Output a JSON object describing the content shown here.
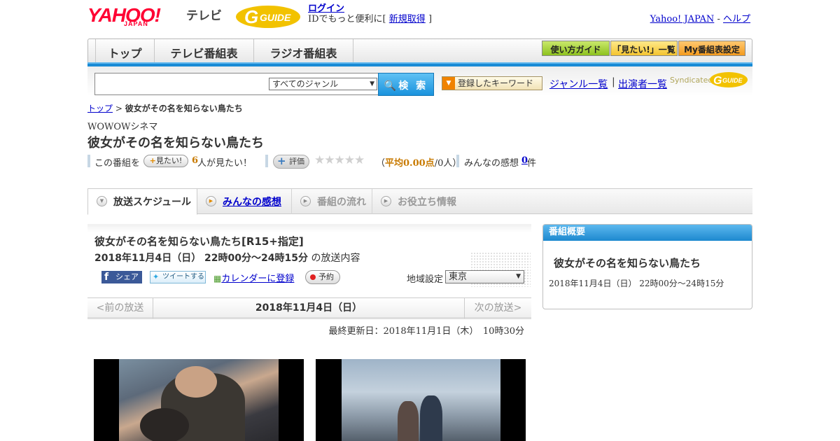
{
  "header": {
    "yahoo_logo": "YAHOO!",
    "yahoo_sub": "JAPAN",
    "tv_label": "テレビ",
    "gguide_logo": "G-GUIDE",
    "login": "ログイン",
    "login_note_pre": "IDでもっと便利に[",
    "signup": "新規取得",
    "login_note_post": "]",
    "yahoo_japan_link": "Yahoo! JAPAN",
    "dash": "-",
    "help_link": "ヘルプ"
  },
  "nav": {
    "tabs": [
      "トップ",
      "テレビ番組表",
      "ラジオ番組表"
    ],
    "guide_btn": "使い方ガイド",
    "watchlist_btn": "「見たい!」一覧",
    "my_btn": "My番組表設定"
  },
  "search": {
    "genre_selected": "すべてのジャンル",
    "button": "検 索",
    "keyword_btn": "登録したキーワード",
    "genre_link": "ジャンル一覧",
    "separator": "|",
    "cast_link": "出演者一覧",
    "syndicated": "Syndicated"
  },
  "breadcrumb": {
    "home": "トップ",
    "sep": ">",
    "current": "彼女がその名を知らない鳥たち"
  },
  "program": {
    "channel": "WOWOWシネマ",
    "title": "彼女がその名を知らない鳥たち",
    "this_program": "この番組を",
    "want_btn": "見たい!",
    "want_count": "6",
    "want_suffix": "人が見たい！",
    "rate_btn": "評価",
    "stars": "★★★★★",
    "avg_open": "（",
    "avg_label": "平均0.00点",
    "avg_rest": "/0人）",
    "impressions_label": "みんなの感想",
    "impressions_count": "0",
    "impressions_unit": "件"
  },
  "tabs": [
    "放送スケジュール",
    "みんなの感想",
    "番組の流れ",
    "お役立ち情報"
  ],
  "broadcast": {
    "title": "彼女がその名を知らない鳥たち[R15+指定]",
    "datetime": "2018年11月4日（日） 22時00分～24時15分",
    "datetime_suffix": "の放送内容",
    "share": "シェア",
    "tweet": "ツイートする",
    "calendar": "カレンダーに登録",
    "reserve": "予約",
    "region_label": "地域設定",
    "region_value": "東京"
  },
  "pager": {
    "prev": "<前の放送",
    "date": "2018年11月4日（日）",
    "next": "次の放送>"
  },
  "updated": "最終更新日：2018年11月1日（木）　10時30分",
  "side": {
    "heading": "番組概要",
    "title": "彼女がその名を知らない鳥たち",
    "time": "2018年11月4日（日） 22時00分～24時15分"
  }
}
